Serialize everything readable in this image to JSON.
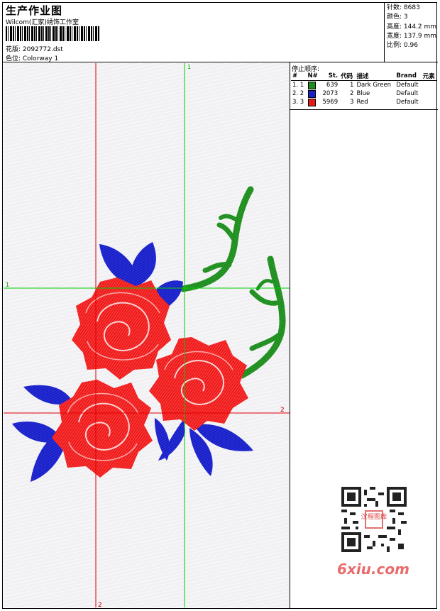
{
  "header": {
    "title": "生产作业图",
    "studio": "Wilcom(汇家)绣饰工作室",
    "file_label": "花版: 2092772.dst",
    "colorway_label": "色位: Colorway 1"
  },
  "stats": {
    "stitches": "针数: 8683",
    "colors": "颜色: 3",
    "height": "高度: 144.2 mm",
    "width": "宽度: 137.9 mm",
    "scale": "比例: 0.96"
  },
  "guides": {
    "v1": "1",
    "h1": "1",
    "v2": "2",
    "h2": "2"
  },
  "stop_sequence": {
    "title": "停止顺序:",
    "columns": [
      "#",
      "N#",
      "St.",
      "代码",
      "描述",
      "Brand",
      "元素"
    ],
    "rows": [
      {
        "num": "1. 1",
        "color": "#1e8c1e",
        "st": "639",
        "code": "1",
        "desc": "Dark Green",
        "brand": "Default"
      },
      {
        "num": "2. 2",
        "color": "#1a20c8",
        "st": "2073",
        "code": "2",
        "desc": "Blue",
        "brand": "Default"
      },
      {
        "num": "3. 3",
        "color": "#e61a1a",
        "st": "5969",
        "code": "3",
        "desc": "Red",
        "brand": "Default"
      }
    ]
  },
  "colors": {
    "guide_red": "#e00000",
    "guide_green": "#00d000",
    "stem": "#1e8c1e",
    "leaf": "#1a20c8",
    "rose": "#f01a1a"
  },
  "watermark": {
    "site": "6xiu.com",
    "qr_badge": "汉程图库"
  }
}
